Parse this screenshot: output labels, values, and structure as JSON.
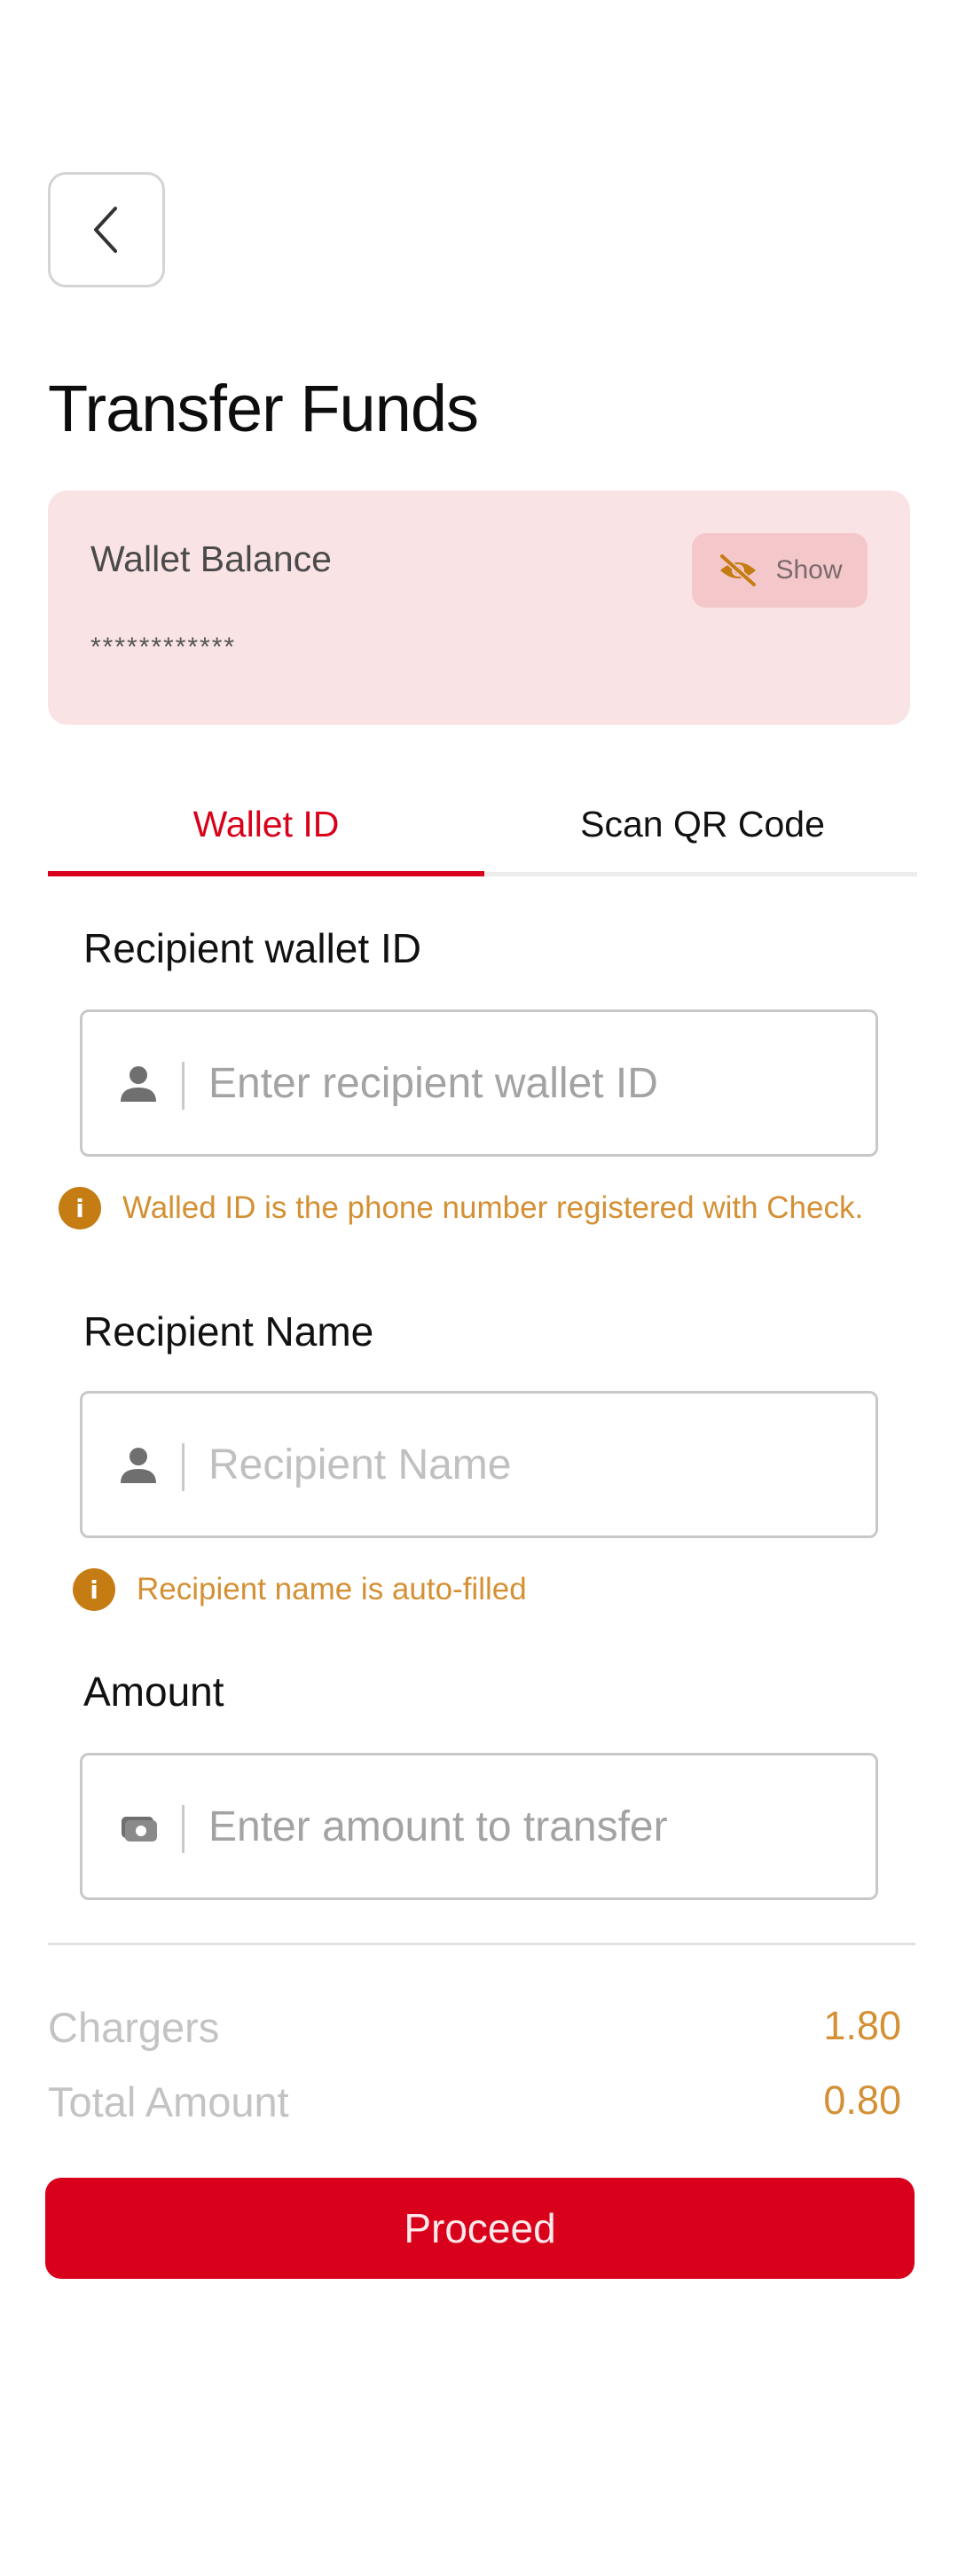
{
  "page": {
    "title": "Transfer Funds"
  },
  "balance": {
    "label": "Wallet Balance",
    "masked_value": "************",
    "toggle_label": "Show",
    "toggle_icon": "eye-off-icon"
  },
  "tabs": [
    {
      "label": "Wallet ID",
      "active": true
    },
    {
      "label": "Scan QR Code",
      "active": false
    }
  ],
  "fields": {
    "wallet_id": {
      "label": "Recipient wallet ID",
      "placeholder": "Enter recipient wallet ID",
      "icon": "person-icon",
      "hint": "Walled ID is the phone number registered with Check."
    },
    "recipient_name": {
      "label": "Recipient Name",
      "placeholder": "Recipient Name",
      "icon": "person-icon",
      "hint": "Recipient name is auto-filled"
    },
    "amount": {
      "label": "Amount",
      "placeholder": "Enter amount to transfer",
      "icon": "money-icon"
    }
  },
  "summary": {
    "charges_label": "Chargers",
    "charges_value": "1.80",
    "total_label": "Total Amount",
    "total_value": "0.80"
  },
  "actions": {
    "proceed_label": "Proceed"
  },
  "colors": {
    "accent": "#d9001b",
    "hint": "#d49034",
    "card_bg": "#fae3e5"
  }
}
